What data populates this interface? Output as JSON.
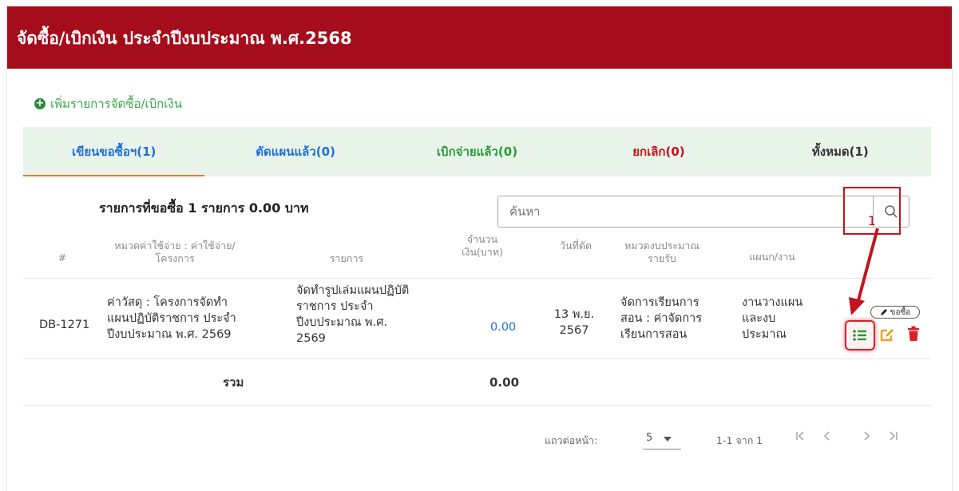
{
  "header": {
    "title": "จัดซื้อ/เบิกเงิน ประจำปีงบประมาณ พ.ศ.2568"
  },
  "add_link": {
    "label": "เพิ่มรายการจัดซื้อ/เบิกเงิน"
  },
  "tabs": [
    {
      "label": "เขียนขอซื้อฯ(1)",
      "color": "#1f6fd6",
      "active": true
    },
    {
      "label": "ตัดแผนแล้ว(0)",
      "color": "#1f6fd6",
      "active": false
    },
    {
      "label": "เบิกจ่ายแล้ว(0)",
      "color": "#2a9a3a",
      "active": false
    },
    {
      "label": "ยกเลิก(0)",
      "color": "#c4141f",
      "active": false
    },
    {
      "label": "ทั้งหมด(1)",
      "color": "#333333",
      "active": false
    }
  ],
  "summary": "รายการที่ขอซื้อ 1 รายการ 0.00 บาท",
  "search": {
    "placeholder": "ค้นหา",
    "value": ""
  },
  "annotation": {
    "number": "1"
  },
  "table": {
    "headers": {
      "index": "#",
      "category": [
        "หมวดค่าใช้จ่าย : ค่าใช้จ่าย/",
        "โครงการ"
      ],
      "item": "รายการ",
      "amount": [
        "จำนวน",
        "เงิน(บาท)"
      ],
      "date": "วันที่ตัด",
      "budget": [
        "หมวดงบประมาณ",
        "รายรับ"
      ],
      "dept": "แผนก/งาน"
    },
    "row": {
      "id": "DB-1271",
      "category": [
        "ค่าวัสดุ : โครงการจัดทำ",
        "แผนปฏิบัติราชการ ประจำ",
        "ปีงบประมาณ พ.ศ. 2569"
      ],
      "item": [
        "จัดทำรูปเล่มแผนปฏิบัติ",
        "ราชการ ประจำ",
        "ปีงบประมาณ พ.ศ.",
        "2569"
      ],
      "amount": "0.00",
      "date": [
        "13 พ.ย.",
        "2567"
      ],
      "budget": [
        "จัดการเรียนการ",
        "สอน : ค่าจัดการ",
        "เรียนการสอน"
      ],
      "dept": [
        "งานวางแผน",
        "และงบ",
        "ประมาณ"
      ],
      "badge": "ขอซื้อ"
    },
    "total": {
      "label": "รวม",
      "value": "0.00"
    }
  },
  "pagination": {
    "rows_per_page_label": "แถวต่อหน้า:",
    "rows_per_page": "5",
    "range": "1-1 จาก 1"
  },
  "colors": {
    "header_bg": "#a50d1c",
    "tab_bg": "#e8f3ea",
    "active_underline": "#e27b2a",
    "amount_link": "#1f6fd6",
    "annotation_red": "#c4141f"
  }
}
